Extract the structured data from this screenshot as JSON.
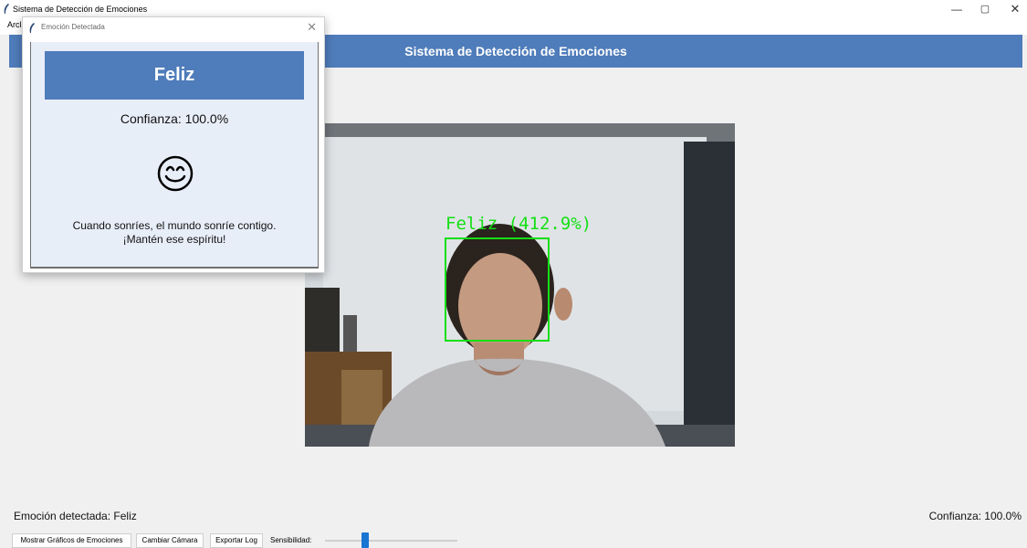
{
  "window": {
    "title": "Sistema de Detección de Emociones",
    "menu_visible_text": "Arcl",
    "controls": {
      "minimize": "—",
      "maximize": "▢",
      "close": "✕"
    }
  },
  "header": {
    "title": "Sistema de Detección de Emociones",
    "color": "#4f7cba"
  },
  "video": {
    "face_label": "Feliz (412.9%)",
    "box_color": "#14e014"
  },
  "status": {
    "emotion_text": "Emoción detectada: Feliz",
    "confidence_text": "Confianza: 100.0%"
  },
  "controls": {
    "charts_button": "Mostrar Gráficos de Emociones",
    "camera_button": "Cambiar Cámara",
    "export_button": "Exportar Log",
    "sensitivity_label": "Sensibilidad:",
    "sensitivity_level": 0.3
  },
  "popup": {
    "title": "Emoción Detectada",
    "close": "✕",
    "emotion": "Feliz",
    "confidence": "Confianza: 100.0%",
    "emoji_icon": "smiling-face-icon",
    "message_line1": "Cuando sonríes, el mundo sonríe contigo.",
    "message_line2": "¡Mantén ese espíritu!"
  }
}
